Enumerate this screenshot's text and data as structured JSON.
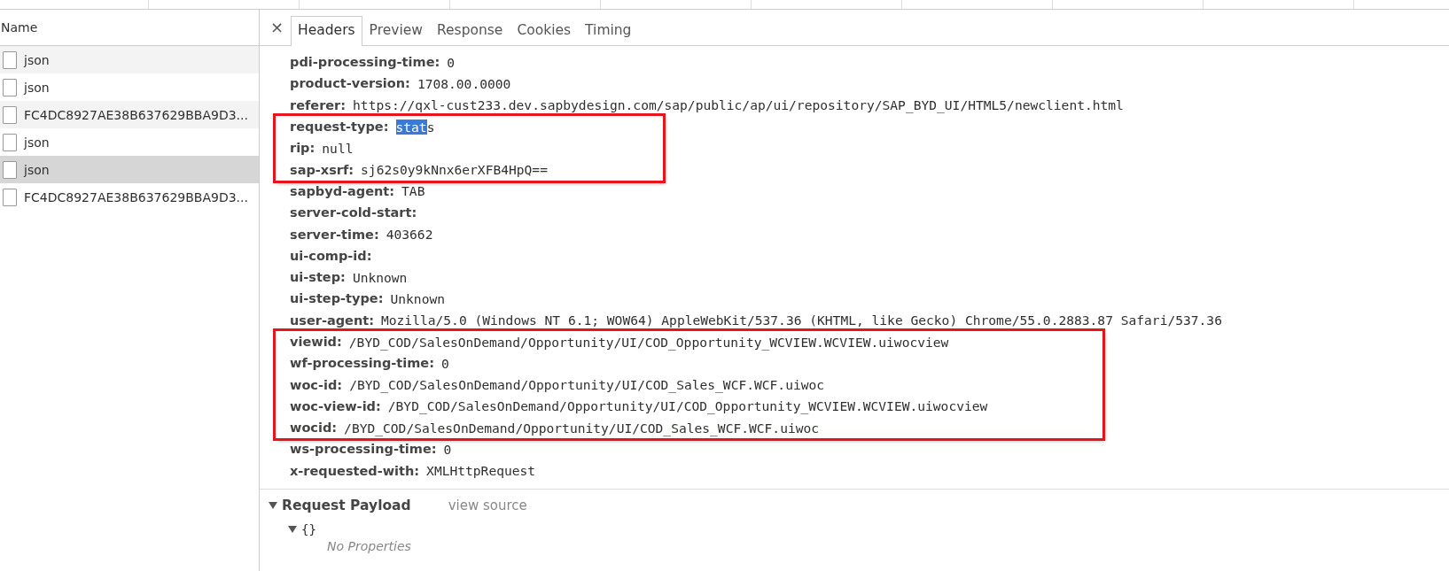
{
  "requests": {
    "column_header": "Name",
    "items": [
      {
        "name": "json",
        "selected": false
      },
      {
        "name": "json",
        "selected": false
      },
      {
        "name": "FC4DC8927AE38B637629BBA9D3...",
        "selected": false
      },
      {
        "name": "json",
        "selected": false
      },
      {
        "name": "json",
        "selected": true
      },
      {
        "name": "FC4DC8927AE38B637629BBA9D3...",
        "selected": false
      }
    ]
  },
  "detail": {
    "close": "×",
    "tabs": [
      {
        "label": "Headers",
        "selected": true
      },
      {
        "label": "Preview",
        "selected": false
      },
      {
        "label": "Response",
        "selected": false
      },
      {
        "label": "Cookies",
        "selected": false
      },
      {
        "label": "Timing",
        "selected": false
      }
    ],
    "header_groups": [
      {
        "outlined": false,
        "rows": [
          {
            "name": "pdi-processing-time:",
            "value": [
              {
                "text": "0",
                "selected": false
              }
            ]
          },
          {
            "name": "product-version:",
            "value": [
              {
                "text": "1708.00.0000",
                "selected": false
              }
            ]
          },
          {
            "name": "referer:",
            "value": [
              {
                "text": "https://qxl-cust233.dev.sapbydesign.com/sap/public/ap/ui/repository/SAP_BYD_UI/HTML5/newclient.html",
                "selected": false
              }
            ]
          }
        ]
      },
      {
        "outlined": true,
        "rows": [
          {
            "name": "request-type:",
            "value": [
              {
                "text": "stat",
                "selected": true
              },
              {
                "text": "s",
                "selected": false
              }
            ]
          },
          {
            "name": "rip:",
            "value": [
              {
                "text": "null",
                "selected": false
              }
            ]
          },
          {
            "name": "sap-xsrf:",
            "value": [
              {
                "text": "sj62s0y9kNnx6erXFB4HpQ==",
                "selected": false
              }
            ]
          }
        ]
      },
      {
        "outlined": false,
        "rows": [
          {
            "name": "sapbyd-agent:",
            "value": [
              {
                "text": "TAB",
                "selected": false
              }
            ]
          },
          {
            "name": "server-cold-start:",
            "value": []
          },
          {
            "name": "server-time:",
            "value": [
              {
                "text": "403662",
                "selected": false
              }
            ]
          },
          {
            "name": "ui-comp-id:",
            "value": []
          },
          {
            "name": "ui-step:",
            "value": [
              {
                "text": "Unknown",
                "selected": false
              }
            ]
          },
          {
            "name": "ui-step-type:",
            "value": [
              {
                "text": "Unknown",
                "selected": false
              }
            ]
          },
          {
            "name": "user-agent:",
            "value": [
              {
                "text": "Mozilla/5.0 (Windows NT 6.1; WOW64) AppleWebKit/537.36 (KHTML, like Gecko) Chrome/55.0.2883.87 Safari/537.36",
                "selected": false
              }
            ]
          }
        ]
      },
      {
        "outlined": true,
        "rows": [
          {
            "name": "viewid:",
            "value": [
              {
                "text": "/BYD_COD/SalesOnDemand/Opportunity/UI/COD_Opportunity_WCVIEW.WCVIEW.uiwocview",
                "selected": false
              }
            ]
          },
          {
            "name": "wf-processing-time:",
            "value": [
              {
                "text": "0",
                "selected": false
              }
            ]
          },
          {
            "name": "woc-id:",
            "value": [
              {
                "text": "/BYD_COD/SalesOnDemand/Opportunity/UI/COD_Sales_WCF.WCF.uiwoc",
                "selected": false
              }
            ]
          },
          {
            "name": "woc-view-id:",
            "value": [
              {
                "text": "/BYD_COD/SalesOnDemand/Opportunity/UI/COD_Opportunity_WCVIEW.WCVIEW.uiwocview",
                "selected": false
              }
            ]
          },
          {
            "name": "wocid:",
            "value": [
              {
                "text": "/BYD_COD/SalesOnDemand/Opportunity/UI/COD_Sales_WCF.WCF.uiwoc",
                "selected": false
              }
            ]
          }
        ]
      },
      {
        "outlined": false,
        "rows": [
          {
            "name": "ws-processing-time:",
            "value": [
              {
                "text": "0",
                "selected": false
              }
            ]
          },
          {
            "name": "x-requested-with:",
            "value": [
              {
                "text": "XMLHttpRequest",
                "selected": false
              }
            ]
          }
        ]
      }
    ],
    "payload": {
      "title": "Request Payload",
      "expanded": true,
      "view_source": "view source",
      "object": {
        "label": "{}",
        "expanded": true,
        "empty_text": "No Properties"
      }
    }
  }
}
